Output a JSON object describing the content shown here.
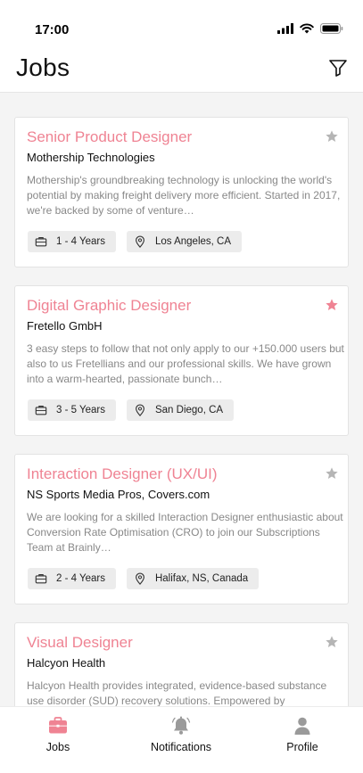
{
  "status_bar": {
    "time": "17:00"
  },
  "header": {
    "title": "Jobs",
    "filter_icon": "filter-icon"
  },
  "colors": {
    "accent": "#ef8393",
    "star_inactive": "#b5b5b5",
    "chip_bg": "#ececec"
  },
  "jobs": [
    {
      "title": "Senior Product Designer",
      "company": "Mothership Technologies",
      "description": "Mothership's groundbreaking technology is unlocking the world's potential by making freight delivery more efficient. Started in 2017, we're backed by some of venture…",
      "experience": "1 - 4 Years",
      "location": "Los Angeles, CA",
      "starred": false
    },
    {
      "title": "Digital Graphic Designer",
      "company": "Fretello GmbH",
      "description": "3 easy steps to follow that not only apply to our +150.000 users but also to us Fretellians and our professional skills. We have grown into a warm-hearted, passionate bunch…",
      "experience": "3 - 5 Years",
      "location": "San Diego, CA",
      "starred": true
    },
    {
      "title": "Interaction Designer (UX/UI)",
      "company": "NS Sports Media Pros, Covers.com",
      "description": "We are looking for a skilled Interaction Designer enthusiastic about Conversion Rate Optimisation (CRO) to join our Subscriptions Team at Brainly…",
      "experience": "2 - 4 Years",
      "location": "Halifax, NS, Canada",
      "starred": false
    },
    {
      "title": "Visual Designer",
      "company": "Halcyon Health",
      "description": "Halcyon Health provides integrated, evidence-based substance use disorder (SUD) recovery solutions. Empowered by",
      "experience": "",
      "location": "",
      "starred": false
    }
  ],
  "tabs": [
    {
      "label": "Jobs",
      "icon": "briefcase-icon",
      "active": true
    },
    {
      "label": "Notifications",
      "icon": "bell-icon",
      "active": false
    },
    {
      "label": "Profile",
      "icon": "person-icon",
      "active": false
    }
  ]
}
